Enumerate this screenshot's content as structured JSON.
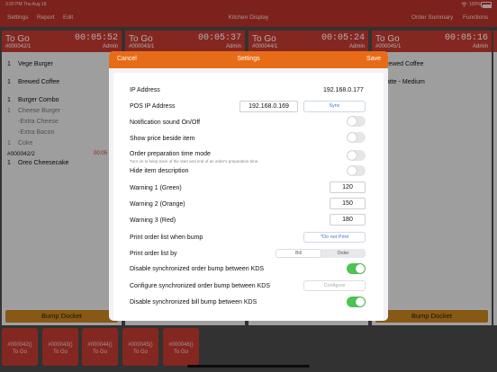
{
  "status_bar": {
    "time_date": "3:20 PM   Thu Aug 18",
    "wifi": "wifi-icon",
    "battery": "100%"
  },
  "nav": {
    "left_items": [
      "Settings",
      "Report",
      "Edit"
    ],
    "title": "Kitchen Display",
    "right_items": [
      "Order Summary",
      "Functions"
    ]
  },
  "columns": [
    {
      "type": "To Go",
      "time": "00:05:52",
      "number": "#000042/1",
      "server": "Admin",
      "items": [
        {
          "qty": "1",
          "name": "Vege Burger"
        },
        {
          "qty": "1",
          "name": "Brewed Coffee"
        },
        {
          "qty": "1",
          "name": "Burger Combo"
        },
        {
          "qty": "1",
          "name": "Cheese Burger"
        },
        {
          "qty": "",
          "name": "-Extra Cheese"
        },
        {
          "qty": "",
          "name": "-Extra Bacon"
        },
        {
          "qty": "1",
          "name": "Coke"
        },
        {
          "qty": "",
          "name": "#000042/2"
        },
        {
          "qty": "1",
          "name": "Oreo Cheesecake"
        }
      ],
      "sub_time": "00:05",
      "bump_label": "Bump Docket"
    },
    {
      "type": "To Go",
      "time": "00:05:37",
      "number": "#000043/1",
      "server": "Admin"
    },
    {
      "type": "To Go",
      "time": "00:05:24",
      "number": "#000044/1",
      "server": "Admin"
    },
    {
      "type": "To Go",
      "time": "00:05:16",
      "number": "#000045/1",
      "server": "Admin",
      "items": [
        {
          "qty": "",
          "name": "rewed Coffee"
        },
        {
          "qty": "",
          "name": "atte - Medium"
        }
      ],
      "bump_label": "Bump Docket"
    }
  ],
  "tickets": [
    {
      "number": "#000042()",
      "type": "To Go"
    },
    {
      "number": "#000043()",
      "type": "To Go"
    },
    {
      "number": "#000044()",
      "type": "To Go"
    },
    {
      "number": "#000045()",
      "type": "To Go"
    },
    {
      "number": "#000046()",
      "type": "To Go"
    }
  ],
  "settings": {
    "header": {
      "cancel": "Cancel",
      "title": "Settings",
      "save": "Save"
    },
    "ip_label": "IP Address",
    "ip_value": "192.168.0.177",
    "pos_ip_label": "POS IP Address",
    "pos_ip_value": "192.168.0.169",
    "sync_label": "Sync",
    "notification_label": "Notification sound On/Off",
    "notification_on": false,
    "show_price_label": "Show price beside item",
    "show_price_on": false,
    "prep_time_label": "Order preparation time mode",
    "prep_time_sub": "Turn on to keep track of the start and end of an order's preparation time.",
    "prep_time_on": false,
    "hide_desc_label": "Hide item description",
    "hide_desc_on": false,
    "warning1_label": "Warning 1 (Green)",
    "warning1_value": "120",
    "warning2_label": "Warning 2 (Orange)",
    "warning2_value": "150",
    "warning3_label": "Warning 3 (Red)",
    "warning3_value": "180",
    "print_list_label": "Print order list when bump",
    "print_list_value": "*Do not Print",
    "print_by_label": "Print order list by",
    "print_by_options": [
      "Bill",
      "Order"
    ],
    "print_by_selected": "Bill",
    "disable_sync_order_label": "Disable synchronized order bump between KDS",
    "disable_sync_order_on": true,
    "configure_sync_label": "Configure synchronized order bump between KDS",
    "configure_button": "Configure",
    "disable_sync_bill_label": "Disable synchronized bill bump between KDS",
    "disable_sync_bill_on": true
  },
  "colors": {
    "header_red": "#c53a32",
    "nav_red": "#b8322b",
    "modal_orange": "#e86c17",
    "toggle_green": "#4cc44f",
    "bump_amber": "#c98420"
  }
}
